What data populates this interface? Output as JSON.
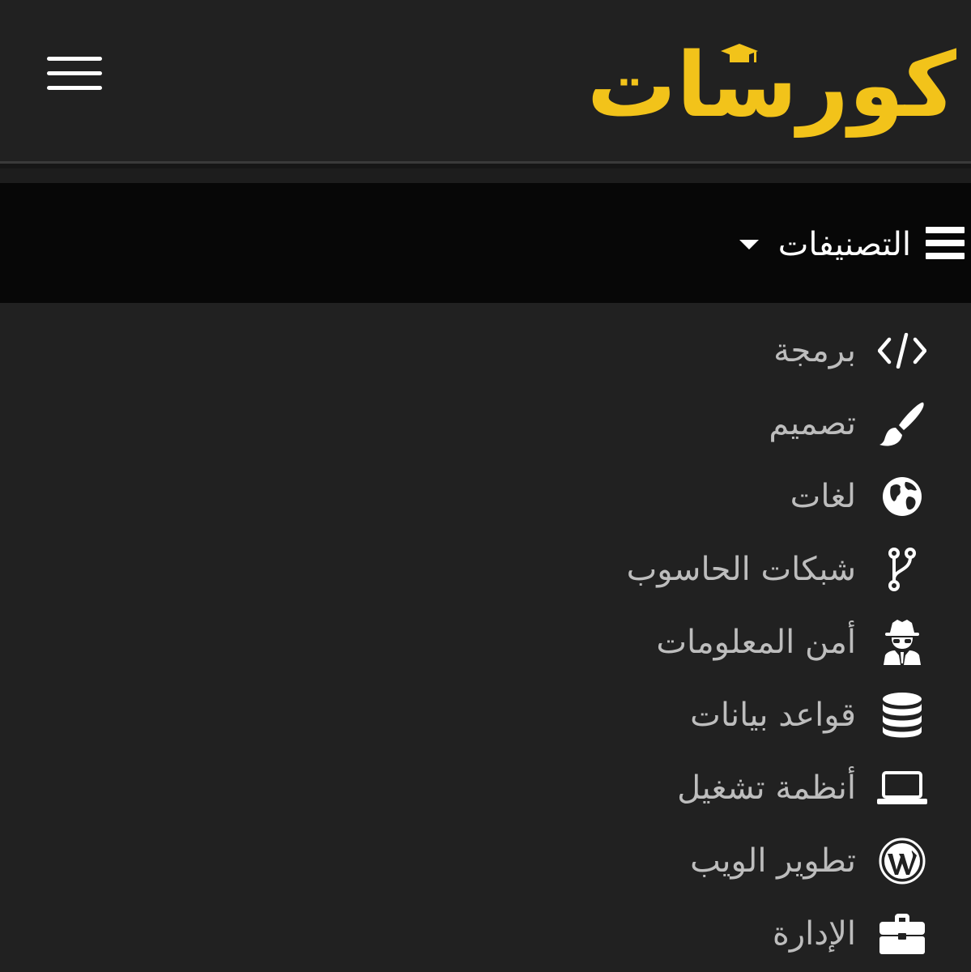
{
  "header": {
    "logo_text": "كورسات",
    "menu_button": "hamburger-menu"
  },
  "categories": {
    "title": "التصنيفات",
    "items": [
      {
        "label": "برمجة",
        "icon": "code-icon"
      },
      {
        "label": "تصميم",
        "icon": "paintbrush-icon"
      },
      {
        "label": "لغات",
        "icon": "globe-icon"
      },
      {
        "label": "شبكات الحاسوب",
        "icon": "code-branch-icon"
      },
      {
        "label": "أمن المعلومات",
        "icon": "user-secret-icon"
      },
      {
        "label": "قواعد بيانات",
        "icon": "database-icon"
      },
      {
        "label": "أنظمة تشغيل",
        "icon": "laptop-icon"
      },
      {
        "label": "تطوير الويب",
        "icon": "wordpress-icon"
      },
      {
        "label": "الإدارة",
        "icon": "briefcase-icon"
      }
    ]
  },
  "colors": {
    "background": "#212121",
    "category_bar": "#070707",
    "logo": "#f2c31a",
    "item_text": "#bdbdbd"
  }
}
